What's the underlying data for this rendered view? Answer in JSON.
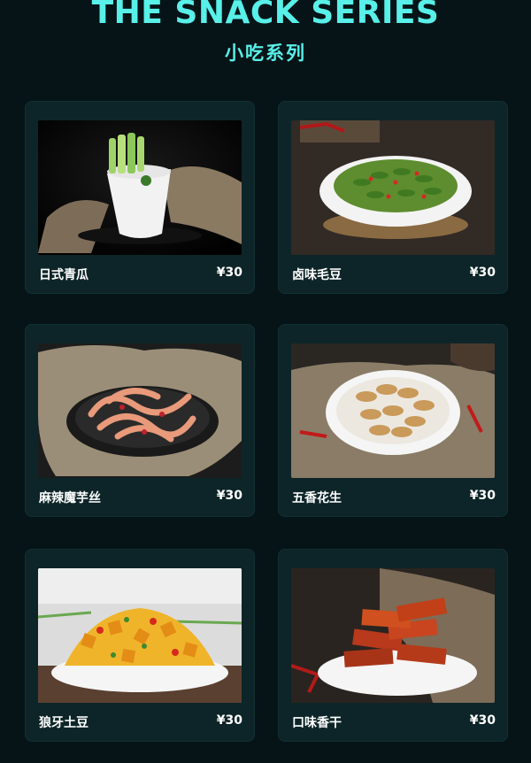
{
  "header": {
    "title_en": "THE SNACK SERIES",
    "title_zh": "小吃系列"
  },
  "items": [
    {
      "name": "日式青瓜",
      "price": "¥30",
      "image": "cucumber-cup-image"
    },
    {
      "name": "卤味毛豆",
      "price": "¥30",
      "image": "edamame-bowl-image"
    },
    {
      "name": "麻辣魔芋丝",
      "price": "¥30",
      "image": "konjac-noodles-image"
    },
    {
      "name": "五香花生",
      "price": "¥30",
      "image": "peanuts-bowl-image"
    },
    {
      "name": "狼牙土豆",
      "price": "¥30",
      "image": "potato-fries-image"
    },
    {
      "name": "口味香干",
      "price": "¥30",
      "image": "spiced-tofu-image"
    }
  ],
  "colors": {
    "background": "#061417",
    "card": "#0d2528",
    "accent": "#58f0e9"
  }
}
